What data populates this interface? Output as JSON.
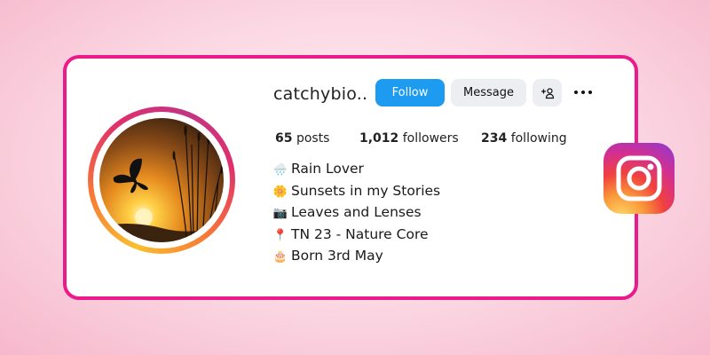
{
  "profile": {
    "username": "catchybio..",
    "follow_label": "Follow",
    "message_label": "Message",
    "add_user_icon": "add-user-icon",
    "more_icon": "more-horizontal-icon"
  },
  "stats": {
    "posts_count": "65",
    "posts_label": "posts",
    "followers_count": "1,012",
    "followers_label": "followers",
    "following_count": "234",
    "following_label": "following"
  },
  "bio": {
    "lines": [
      {
        "icon": "rain-cloud-icon",
        "text": "Rain Lover"
      },
      {
        "icon": "daisy-flower-icon",
        "text": "Sunsets in my Stories"
      },
      {
        "icon": "camera-icon",
        "text": "Leaves and Lenses"
      },
      {
        "icon": "pin-icon",
        "text": "TN 23 - Nature Core"
      },
      {
        "icon": "birthday-cake-icon",
        "text": "Born 3rd May"
      }
    ]
  },
  "colors": {
    "card_border": "#ec1b8c",
    "follow_button": "#1c9bf0",
    "secondary_button": "#eceef1"
  },
  "brand": {
    "logo_icon": "instagram-logo-icon"
  }
}
